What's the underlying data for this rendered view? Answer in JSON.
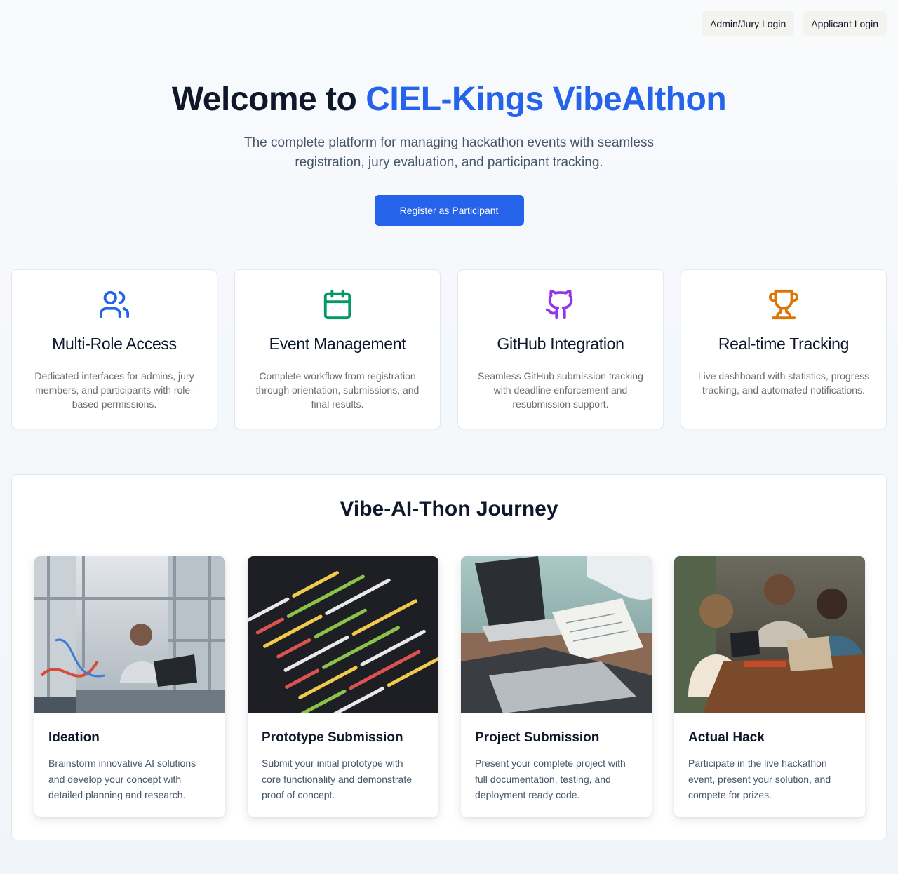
{
  "nav": {
    "admin_login": "Admin/Jury Login",
    "applicant_login": "Applicant Login"
  },
  "hero": {
    "title_prefix": "Welcome to",
    "title_accent": "CIEL-Kings VibeAIthon",
    "subtitle": "The complete platform for managing hackathon events with seamless registration, jury evaluation, and participant tracking.",
    "cta": "Register as Participant"
  },
  "features": [
    {
      "icon": "users-icon",
      "color": "#2563eb",
      "title": "Multi-Role Access",
      "text": "Dedicated interfaces for admins, jury members, and participants with role-based permissions."
    },
    {
      "icon": "calendar-icon",
      "color": "#059669",
      "title": "Event Management",
      "text": "Complete workflow from registration through orientation, submissions, and final results."
    },
    {
      "icon": "github-icon",
      "color": "#9333ea",
      "title": "GitHub Integration",
      "text": "Seamless GitHub submission tracking with deadline enforcement and resubmission support."
    },
    {
      "icon": "trophy-icon",
      "color": "#d97706",
      "title": "Real-time Tracking",
      "text": "Live dashboard with statistics, progress tracking, and automated notifications."
    }
  ],
  "journey": {
    "title": "Vibe-AI-Thon Journey",
    "steps": [
      {
        "image": "engineer-at-laptop-photo",
        "title": "Ideation",
        "text": "Brainstorm innovative AI solutions and develop your concept with detailed planning and research."
      },
      {
        "image": "code-on-screen-photo",
        "title": "Prototype Submission",
        "text": "Submit your initial prototype with core functionality and demonstrate proof of concept."
      },
      {
        "image": "laptop-and-notes-photo",
        "title": "Project Submission",
        "text": "Present your complete project with full documentation, testing, and deployment ready code."
      },
      {
        "image": "team-at-cafe-photo",
        "title": "Actual Hack",
        "text": "Participate in the live hackathon event, present your solution, and compete for prizes."
      }
    ]
  }
}
